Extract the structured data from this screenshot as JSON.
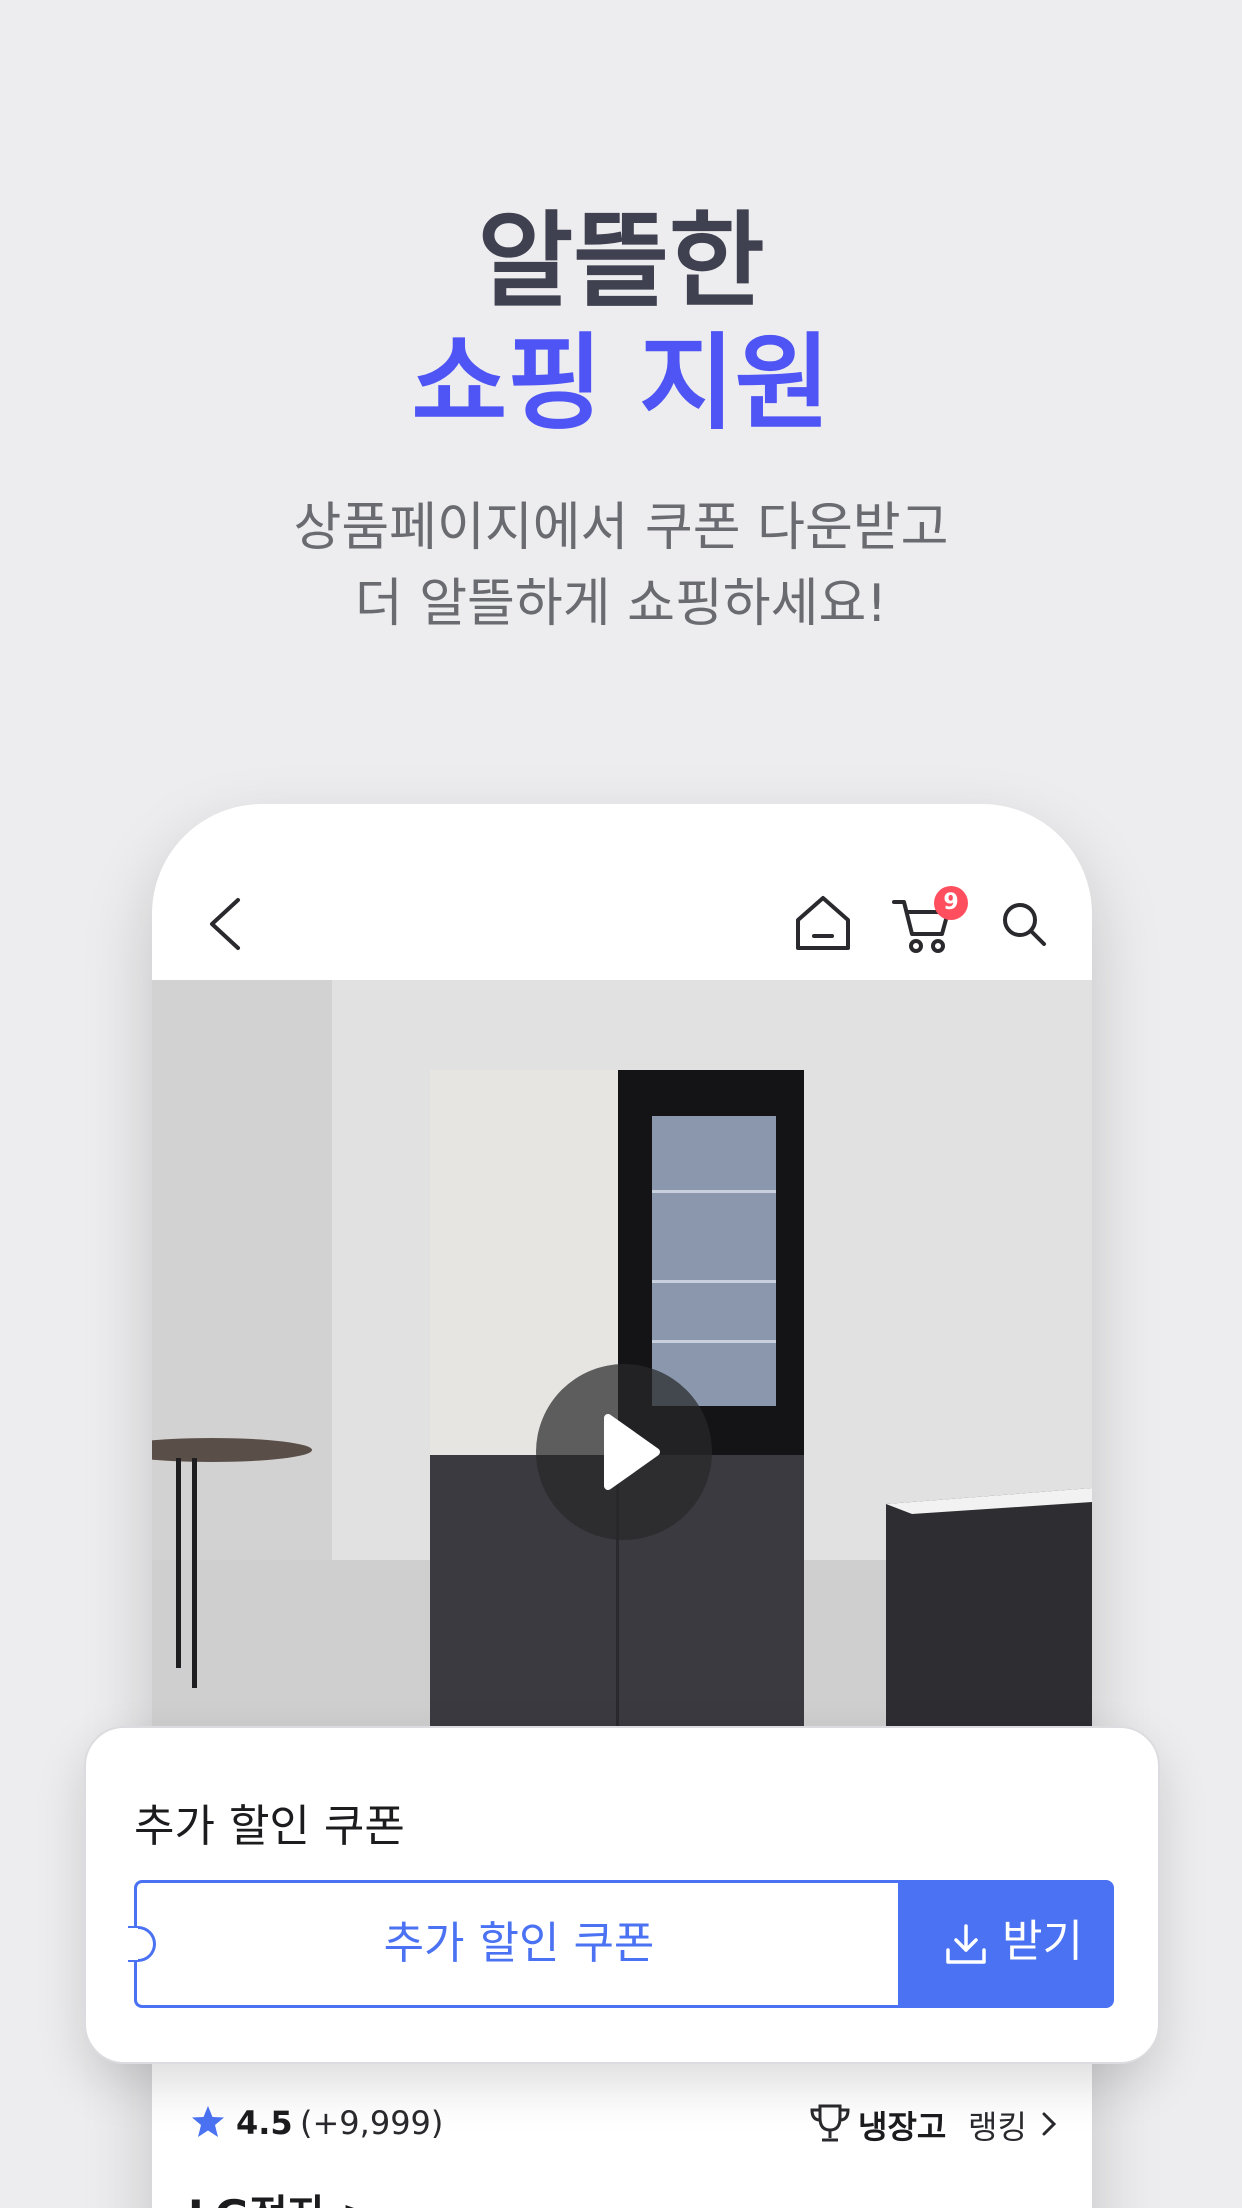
{
  "headline": {
    "line1": "알뜰한",
    "line2": "쇼핑 지원"
  },
  "subtext": {
    "line1": "상품페이지에서 쿠폰 다운받고",
    "line2": "더 알뜰하게 쇼핑하세요!"
  },
  "colors": {
    "accent": "#4f55f5",
    "coupon_blue": "#4a72f2",
    "badge_red": "#ff4f5e",
    "star_blue": "#4a72f2"
  },
  "appbar": {
    "icons": [
      "back-chevron-icon",
      "home-icon",
      "cart-icon",
      "search-icon"
    ],
    "cart_badge": "9"
  },
  "coupon": {
    "title": "추가 할인 쿠폰",
    "ticket_label": "추가 할인 쿠폰",
    "get_label": "받기",
    "get_icon": "download-icon"
  },
  "product": {
    "rating": "4.5",
    "review_count": "(+9,999)",
    "ranking_category": "냉장고",
    "ranking_label": "랭킹",
    "brand": "LG전자 >"
  }
}
